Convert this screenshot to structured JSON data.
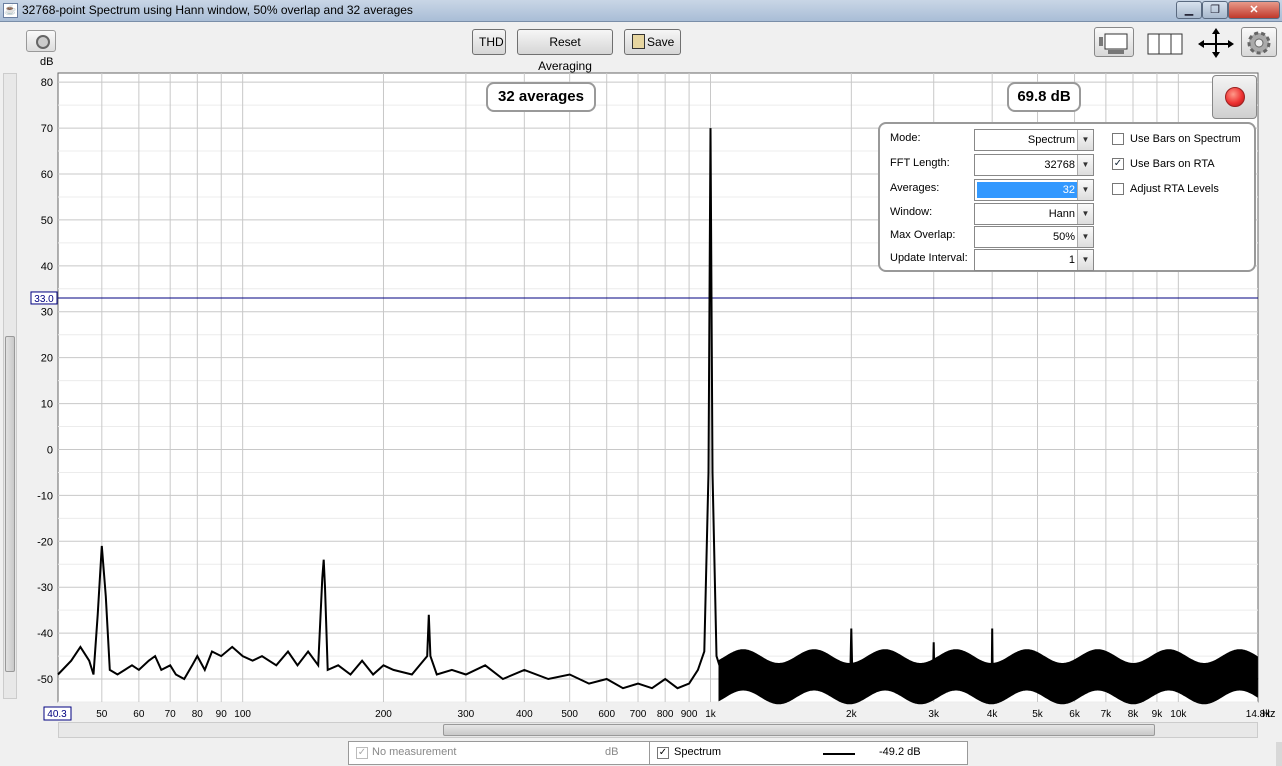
{
  "window": {
    "title": "32768-point Spectrum using Hann window, 50% overlap and 32 averages",
    "controls": {
      "minimize": "▁",
      "maximize": "❐",
      "close": "✕"
    }
  },
  "toolbar": {
    "thd_label": "THD",
    "reset_label": "Reset Averaging",
    "save_label": "Save",
    "icons": [
      "camera-icon",
      "graph-layout-icon",
      "columns-icon",
      "pan-arrows-icon",
      "gear-icon"
    ]
  },
  "overlay": {
    "averages_text": "32 averages",
    "level_text": "69.8 dB"
  },
  "settings": {
    "mode_label": "Mode:",
    "mode_value": "Spectrum",
    "fft_label": "FFT Length:",
    "fft_value": "32768",
    "averages_label": "Averages:",
    "averages_value": "32",
    "window_label": "Window:",
    "window_value": "Hann",
    "overlap_label": "Max Overlap:",
    "overlap_value": "50%",
    "interval_label": "Update Interval:",
    "interval_value": "1",
    "bars_spectrum_label": "Use Bars on Spectrum",
    "bars_spectrum_checked": false,
    "bars_rta_label": "Use Bars on RTA",
    "bars_rta_checked": true,
    "adjust_rta_label": "Adjust RTA Levels",
    "adjust_rta_checked": false
  },
  "legend": {
    "no_measurement_label": "No measurement",
    "no_measurement_unit": "dB",
    "spectrum_label": "Spectrum",
    "spectrum_value": "-49.2 dB",
    "checkmark": "✓"
  },
  "chart_data": {
    "type": "line",
    "x_scale": "log",
    "xlim": [
      40.3,
      14800
    ],
    "ylim": [
      -55,
      82
    ],
    "ylabel": "dB",
    "xunit": "Hz",
    "y_ticks": [
      80,
      70,
      60,
      50,
      40,
      30,
      20,
      10,
      0,
      -10,
      -20,
      -30,
      -40,
      -50
    ],
    "x_tick_labels": [
      {
        "v": 50,
        "t": "50"
      },
      {
        "v": 60,
        "t": "60"
      },
      {
        "v": 70,
        "t": "70"
      },
      {
        "v": 80,
        "t": "80"
      },
      {
        "v": 90,
        "t": "90"
      },
      {
        "v": 100,
        "t": "100"
      },
      {
        "v": 200,
        "t": "200"
      },
      {
        "v": 300,
        "t": "300"
      },
      {
        "v": 400,
        "t": "400"
      },
      {
        "v": 500,
        "t": "500"
      },
      {
        "v": 600,
        "t": "600"
      },
      {
        "v": 700,
        "t": "700"
      },
      {
        "v": 800,
        "t": "800"
      },
      {
        "v": 900,
        "t": "900"
      },
      {
        "v": 1000,
        "t": "1k"
      },
      {
        "v": 2000,
        "t": "2k"
      },
      {
        "v": 3000,
        "t": "3k"
      },
      {
        "v": 4000,
        "t": "4k"
      },
      {
        "v": 5000,
        "t": "5k"
      },
      {
        "v": 6000,
        "t": "6k"
      },
      {
        "v": 7000,
        "t": "7k"
      },
      {
        "v": 8000,
        "t": "8k"
      },
      {
        "v": 9000,
        "t": "9k"
      },
      {
        "v": 10000,
        "t": "10k"
      },
      {
        "v": 14800,
        "t": "14.8k"
      }
    ],
    "x_start_label": "40.3",
    "cursor_y": 33.0,
    "cursor_y_label": "33.0",
    "series": [
      {
        "name": "Spectrum",
        "color": "#000000",
        "points": [
          [
            40.3,
            -49
          ],
          [
            43,
            -46
          ],
          [
            45,
            -43
          ],
          [
            47,
            -46
          ],
          [
            48,
            -49
          ],
          [
            49,
            -36
          ],
          [
            50,
            -21
          ],
          [
            51,
            -32
          ],
          [
            52,
            -48
          ],
          [
            54,
            -49
          ],
          [
            56,
            -48
          ],
          [
            58,
            -47
          ],
          [
            60,
            -48
          ],
          [
            63,
            -46
          ],
          [
            65,
            -45
          ],
          [
            67,
            -48
          ],
          [
            70,
            -47
          ],
          [
            72,
            -49
          ],
          [
            75,
            -50
          ],
          [
            78,
            -47
          ],
          [
            80,
            -45
          ],
          [
            83,
            -48
          ],
          [
            86,
            -44
          ],
          [
            90,
            -45
          ],
          [
            95,
            -43
          ],
          [
            100,
            -45
          ],
          [
            105,
            -46
          ],
          [
            110,
            -45
          ],
          [
            118,
            -47
          ],
          [
            125,
            -44
          ],
          [
            131,
            -47
          ],
          [
            138,
            -44
          ],
          [
            145,
            -47
          ],
          [
            148,
            -28
          ],
          [
            149,
            -24
          ],
          [
            150,
            -30
          ],
          [
            152,
            -48
          ],
          [
            160,
            -47
          ],
          [
            170,
            -49
          ],
          [
            180,
            -46
          ],
          [
            190,
            -49
          ],
          [
            200,
            -47
          ],
          [
            210,
            -48
          ],
          [
            230,
            -49
          ],
          [
            248,
            -45
          ],
          [
            250,
            -36
          ],
          [
            252,
            -45
          ],
          [
            260,
            -49
          ],
          [
            280,
            -48
          ],
          [
            300,
            -49
          ],
          [
            330,
            -47
          ],
          [
            360,
            -50
          ],
          [
            400,
            -48
          ],
          [
            450,
            -50
          ],
          [
            500,
            -49
          ],
          [
            550,
            -51
          ],
          [
            600,
            -50
          ],
          [
            650,
            -52
          ],
          [
            700,
            -51
          ],
          [
            750,
            -52
          ],
          [
            800,
            -50
          ],
          [
            850,
            -52
          ],
          [
            900,
            -51
          ],
          [
            940,
            -48
          ],
          [
            970,
            -44
          ],
          [
            990,
            -5
          ],
          [
            1000,
            70
          ],
          [
            1010,
            -5
          ],
          [
            1030,
            -45
          ],
          [
            1060,
            -49
          ],
          [
            1200,
            -48
          ],
          [
            1500,
            -50
          ],
          [
            1990,
            -49
          ],
          [
            2000,
            -39
          ],
          [
            2010,
            -49
          ],
          [
            2500,
            -49
          ],
          [
            2990,
            -50
          ],
          [
            3000,
            -42
          ],
          [
            3010,
            -50
          ],
          [
            3500,
            -48
          ],
          [
            3990,
            -50
          ],
          [
            4000,
            -39
          ],
          [
            4010,
            -50
          ],
          [
            5000,
            -49
          ],
          [
            6000,
            -50
          ],
          [
            7000,
            -48
          ],
          [
            8000,
            -50
          ],
          [
            9000,
            -49
          ],
          [
            10000,
            -50
          ],
          [
            12000,
            -49
          ],
          [
            14800,
            -50
          ]
        ]
      }
    ]
  }
}
